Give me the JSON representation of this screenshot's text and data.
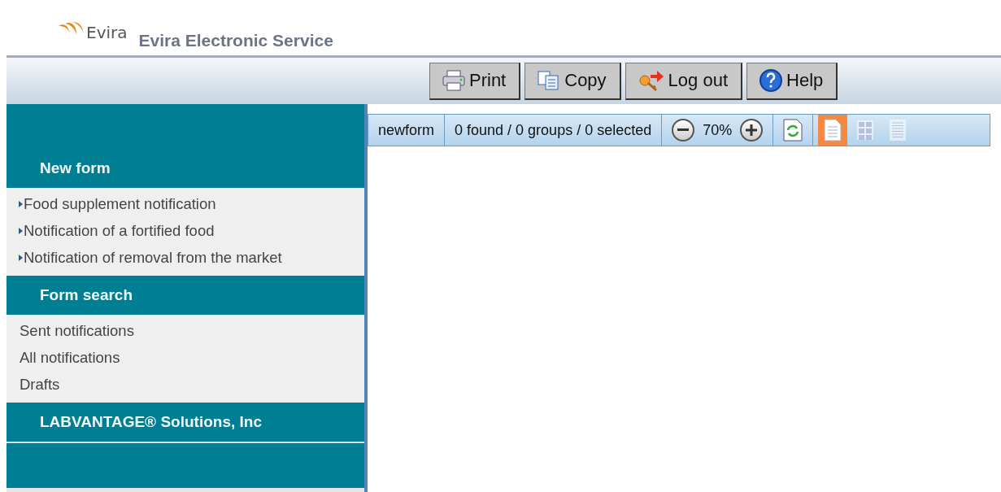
{
  "header": {
    "logo": "Evira",
    "title": "Evira Electronic Service"
  },
  "toolbar": [
    {
      "kind": "print",
      "label": "Print"
    },
    {
      "kind": "copy",
      "label": "Copy"
    },
    {
      "kind": "logout",
      "label": "Log out"
    },
    {
      "kind": "help",
      "label": "Help"
    }
  ],
  "sidebar": [
    {
      "heading": "New form",
      "kind": "arrow-links",
      "items": [
        "Food supplement notification",
        "Notification of a fortified food",
        "Notification of removal from the market"
      ]
    },
    {
      "heading": "Form search",
      "kind": "plain-links",
      "items": [
        "Sent notifications",
        "All notifications",
        "Drafts"
      ]
    },
    {
      "heading": "LABVANTAGE® Solutions, Inc",
      "kind": "heading-only"
    }
  ],
  "list_bar": {
    "new_form": "newform",
    "status": "0 found / 0 groups / 0 selected",
    "zoom": "70%",
    "views": [
      {
        "kind": "page",
        "selected": true
      },
      {
        "kind": "grid",
        "selected": false
      },
      {
        "kind": "list",
        "selected": false
      }
    ]
  }
}
